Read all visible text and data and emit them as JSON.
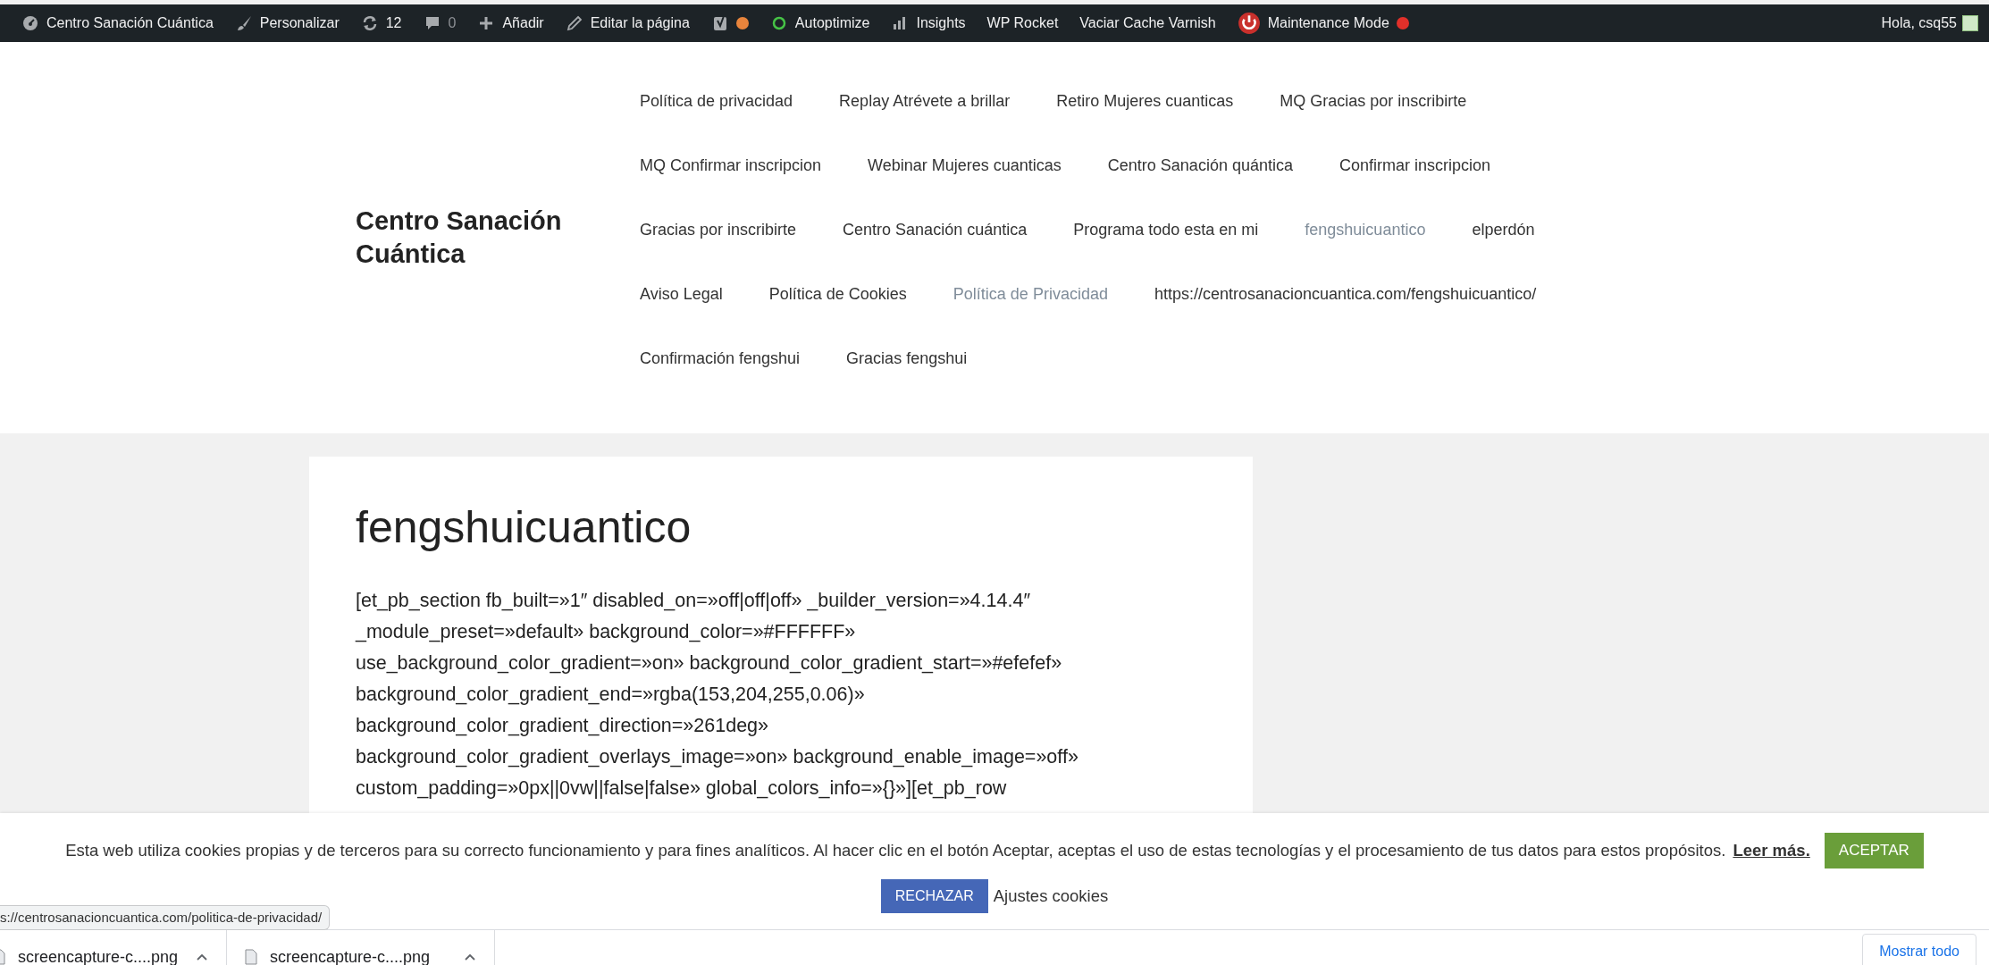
{
  "admin_bar": {
    "items": [
      {
        "kind": "dashboard",
        "label": "Centro Sanación Cuántica"
      },
      {
        "kind": "brush",
        "label": "Personalizar"
      },
      {
        "kind": "refresh",
        "label": "12"
      },
      {
        "kind": "comment",
        "label": "0",
        "dimmed": true
      },
      {
        "kind": "plus",
        "label": "Añadir"
      },
      {
        "kind": "pencil",
        "label": "Editar la página"
      },
      {
        "kind": "seo",
        "color": "#e8843c"
      },
      {
        "kind": "ring",
        "label": "Autoptimize"
      },
      {
        "kind": "bars",
        "label": "Insights"
      },
      {
        "kind": "text",
        "label": "WP Rocket"
      },
      {
        "kind": "text",
        "label": "Vaciar Cache Varnish"
      },
      {
        "kind": "maintenance",
        "label": "Maintenance Mode",
        "color": "#e2302a"
      }
    ],
    "greeting": "Hola, csq55"
  },
  "site_title": "Centro Sanación Cuántica",
  "nav": {
    "rows": [
      [
        {
          "label": "Política de privacidad",
          "current": false
        },
        {
          "label": "Replay Atrévete a brillar",
          "current": false
        },
        {
          "label": "Retiro Mujeres cuanticas",
          "current": false
        },
        {
          "label": "MQ Gracias por inscribirte",
          "current": false
        }
      ],
      [
        {
          "label": "MQ Confirmar inscripcion",
          "current": false
        },
        {
          "label": "Webinar Mujeres cuanticas",
          "current": false
        },
        {
          "label": "Centro Sanación quántica",
          "current": false
        },
        {
          "label": "Confirmar inscripcion",
          "current": false
        }
      ],
      [
        {
          "label": "Gracias por inscribirte",
          "current": false
        },
        {
          "label": "Centro Sanación cuántica",
          "current": false
        },
        {
          "label": "Programa todo esta en mi",
          "current": false
        },
        {
          "label": "fengshuicuantico",
          "current": true
        },
        {
          "label": "elperdón",
          "current": false
        }
      ],
      [
        {
          "label": "Aviso Legal",
          "current": false
        },
        {
          "label": "Política de Cookies",
          "current": false
        },
        {
          "label": "Política de Privacidad",
          "current": true
        },
        {
          "label": "https://centrosanacioncuantica.com/fengshuicuantico/",
          "current": false
        }
      ],
      [
        {
          "label": "Confirmación fengshui",
          "current": false
        },
        {
          "label": "Gracias fengshui",
          "current": false
        }
      ]
    ]
  },
  "article": {
    "title": "fengshuicuantico",
    "lines": [
      "[et_pb_section fb_built=»1″ disabled_on=»off|off|off» _builder_version=»4.14.4″",
      "_module_preset=»default» background_color=»#FFFFFF»",
      "use_background_color_gradient=»on» background_color_gradient_start=»#efefef»",
      "background_color_gradient_end=»rgba(153,204,255,0.06)»",
      "background_color_gradient_direction=»261deg»",
      "background_color_gradient_overlays_image=»on» background_enable_image=»off»",
      "custom_padding=»0px||0vw||false|false» global_colors_info=»{}»][et_pb_row"
    ]
  },
  "cookie_notice": {
    "text": "Esta web utiliza cookies propias y de terceros para su correcto funcionamiento y para fines analíticos. Al hacer clic en el botón Aceptar, aceptas el uso de estas tecnologías y el procesamiento de tus datos para estos propósitos.",
    "link": "Leer más.",
    "accept": "ACEPTAR",
    "reject": "RECHAZAR",
    "settings": "Ajustes cookies"
  },
  "status_url": "s://centrosanacioncuantica.com/politica-de-privacidad/",
  "downloads": {
    "items": [
      {
        "name": "screencapture-c....png"
      },
      {
        "name": "screencapture-c....png"
      }
    ],
    "show_all": "Mostrar todo"
  }
}
